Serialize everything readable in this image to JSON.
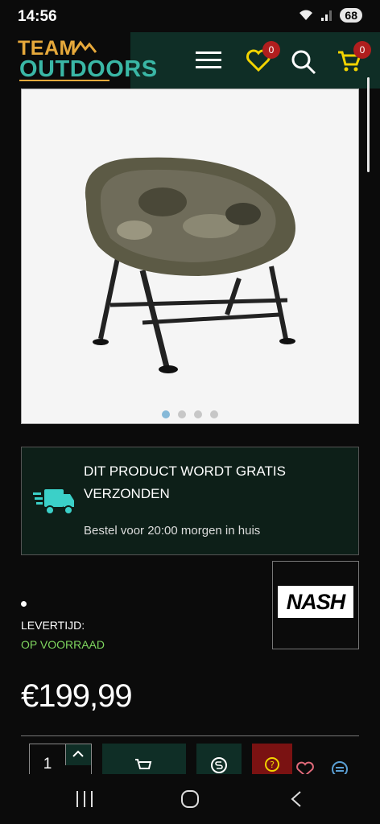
{
  "status_bar": {
    "time": "14:56",
    "battery": "68"
  },
  "header": {
    "logo_top": "TEAM",
    "logo_bottom": "OUTDOORS",
    "wishlist_count": "0",
    "cart_count": "0"
  },
  "gallery": {
    "image_icon": "camo-moon-chair-image",
    "slide_count": 4,
    "active_slide": 1
  },
  "shipping": {
    "title": "DIT PRODUCT WORDT GRATIS VERZONDEN",
    "subtitle": "Bestel voor 20:00 morgen in huis"
  },
  "brand": {
    "name": "NASH"
  },
  "availability": {
    "label": "LEVERTIJD:",
    "value": "OP VOORRAAD"
  },
  "product": {
    "price": "€199,99",
    "quantity": "1"
  },
  "colors": {
    "header_bg": "#0f2e26",
    "accent_teal": "#3ab7a6",
    "logo_orange": "#e7a93b",
    "stock_green": "#7fd65f",
    "badge_red": "#b01e1e"
  }
}
